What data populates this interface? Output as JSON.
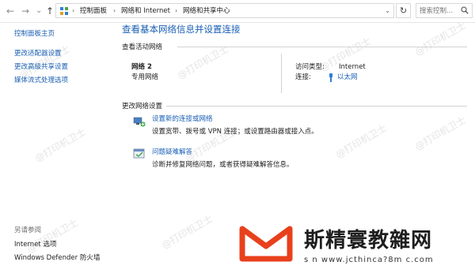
{
  "address_bar": {
    "back": "←",
    "forward": "→",
    "recent": "⌄",
    "up": "↑",
    "breadcrumbs": [
      "控制面板",
      "网络和 Internet",
      "网络和共享中心"
    ],
    "search_placeholder": "搜索控制..."
  },
  "left_pane": {
    "home": "控制面板主页",
    "links": [
      "更改适配器设置",
      "更改高级共享设置",
      "媒体流式处理选项"
    ],
    "see_also": "另请参阅",
    "see_also_links": [
      "Internet 选项",
      "Windows Defender 防火墙"
    ]
  },
  "main": {
    "title": "查看基本网络信息并设置连接",
    "active_section": "查看活动网络",
    "network_name": "网络 2",
    "network_type": "专用网络",
    "access_type_label": "访问类型:",
    "access_type_value": "Internet",
    "connection_label": "连接:",
    "connection_value": "以太网",
    "change_section": "更改网络设置",
    "tasks": [
      {
        "link": "设置新的连接或网络",
        "desc": "设置宽带、拨号或 VPN 连接；或设置路由器或接入点。",
        "icon": "new-connection-icon"
      },
      {
        "link": "问题疑难解答",
        "desc": "诊断并修复网络问题，或者获得疑难解答信息。",
        "icon": "troubleshoot-icon"
      }
    ]
  },
  "watermark_text": "@打印机卫士",
  "brand": {
    "name": "斯精寰教雜网",
    "url": "s n  www.jcthinca?8m c.com"
  },
  "colors": {
    "link": "#1a5fb4",
    "brand_red": "#e8401c"
  }
}
